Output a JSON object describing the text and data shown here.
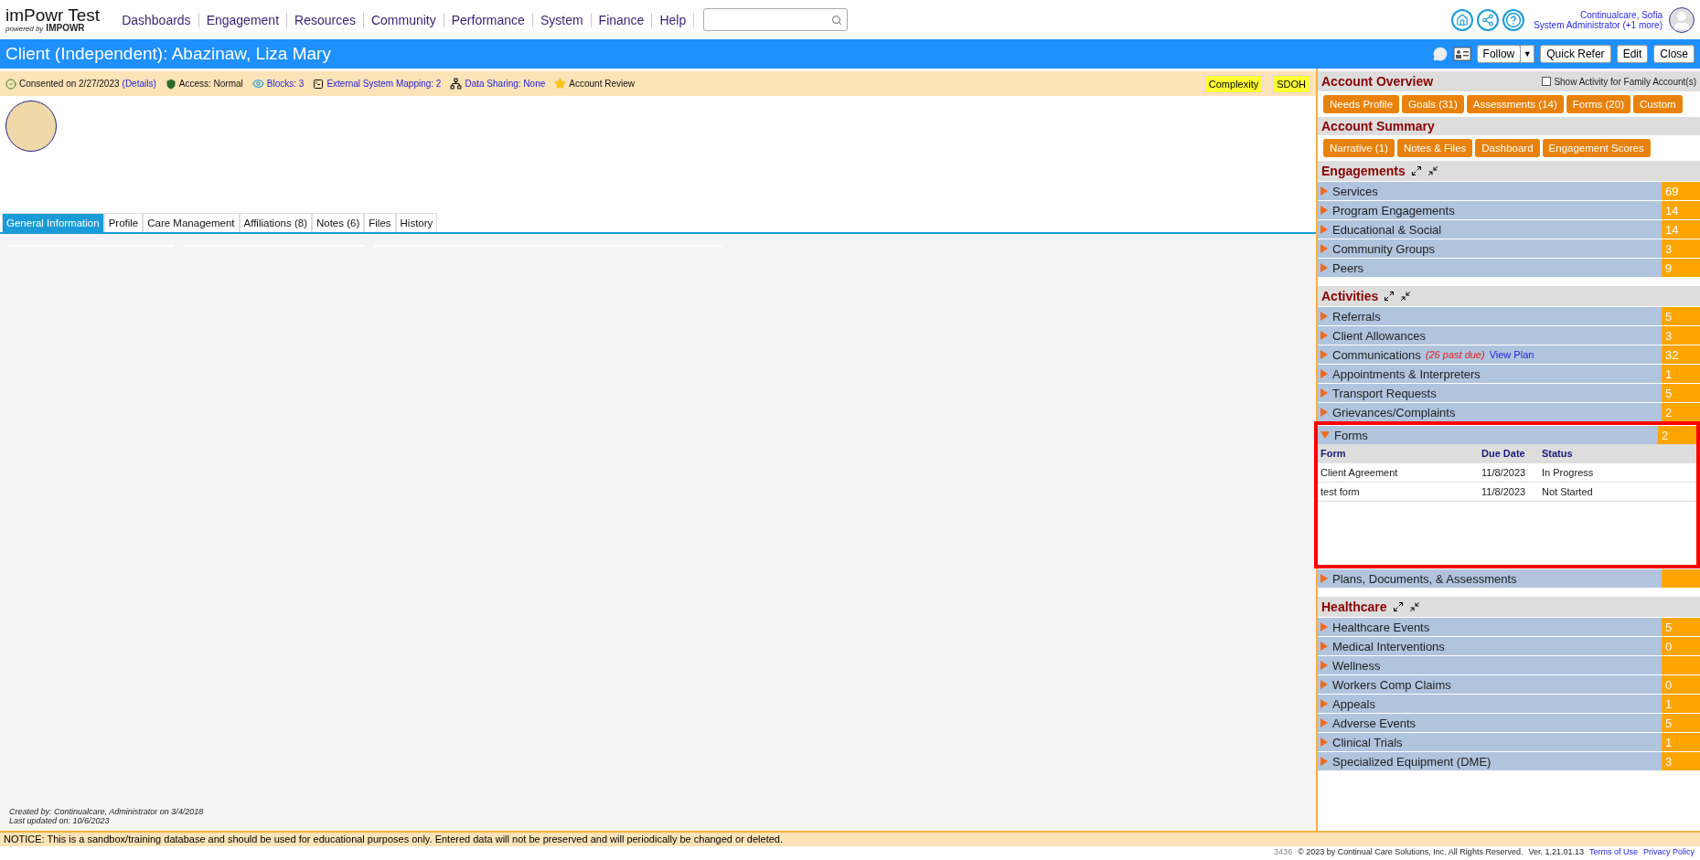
{
  "header": {
    "app_title": "imPowr Test",
    "powered_by": "powered by",
    "brand": "IMPOWR",
    "nav": [
      "Dashboards",
      "Engagement",
      "Resources",
      "Community",
      "Performance",
      "System",
      "Finance",
      "Help"
    ],
    "user": {
      "name": "Continualcare, Sofia",
      "role": "System Administrator (+1 more)"
    }
  },
  "title_bar": {
    "title": "Client (Independent): Abazinaw, Liza Mary",
    "follow": "Follow",
    "follow_menu": "▼",
    "buttons": [
      "Quick Refer",
      "Edit",
      "Close"
    ]
  },
  "info_bar": {
    "items": [
      {
        "kind": "consent",
        "text": "Consented on 2/27/2023",
        "detail": "(Details)",
        "link": false
      },
      {
        "kind": "access",
        "text": "Access: Normal",
        "link": false
      },
      {
        "kind": "blocks",
        "text": "Blocks: 3",
        "link": true
      },
      {
        "kind": "mapping",
        "text": "External System Mapping: 2",
        "link": true
      },
      {
        "kind": "sharing",
        "text": "Data Sharing: None",
        "link": true
      },
      {
        "kind": "review",
        "text": "Account Review",
        "link": false
      }
    ],
    "tags": [
      "Complexity",
      "SDOH"
    ]
  },
  "tabs": [
    {
      "label": "General Information",
      "selected": true
    },
    {
      "label": "Profile",
      "selected": false
    },
    {
      "label": "Care Management",
      "selected": false
    },
    {
      "label": "Affiliations (8)",
      "selected": false
    },
    {
      "label": "Notes (6)",
      "selected": false
    },
    {
      "label": "Files",
      "selected": false
    },
    {
      "label": "History",
      "selected": false
    }
  ],
  "record_info": {
    "created": "Created by: Continualcare, Administrator on 3/4/2018",
    "updated": "Last updated on: 10/6/2023"
  },
  "account_overview": {
    "title": "Account Overview",
    "family_toggle": {
      "label": "Show Activity for Family Account(s)",
      "checked": false
    },
    "buttons": [
      "Needs Profile",
      "Goals (31)",
      "Assessments (14)",
      "Forms (20)",
      "Custom"
    ]
  },
  "account_summary": {
    "title": "Account Summary",
    "buttons": [
      "Narrative (1)",
      "Notes & Files",
      "Dashboard",
      "Engagement Scores"
    ]
  },
  "sections": [
    {
      "title": "Engagements",
      "rows": [
        {
          "label": "Services",
          "count": "69",
          "expanded": false,
          "highlighted": false
        },
        {
          "label": "Program Engagements",
          "count": "14",
          "expanded": false,
          "highlighted": false
        },
        {
          "label": "Educational & Social",
          "count": "14",
          "expanded": false,
          "highlighted": false
        },
        {
          "label": "Community Groups",
          "count": "3",
          "expanded": false,
          "highlighted": false
        },
        {
          "label": "Peers",
          "count": "9",
          "expanded": false,
          "highlighted": false
        }
      ]
    },
    {
      "title": "Activities",
      "rows": [
        {
          "label": "Referrals",
          "count": "5",
          "expanded": false,
          "highlighted": false
        },
        {
          "label": "Client Allowances",
          "count": "3",
          "expanded": false,
          "highlighted": false
        },
        {
          "label": "Communications",
          "note": "(26 past due)",
          "link": "View Plan",
          "count": "32",
          "expanded": false,
          "highlighted": false
        },
        {
          "label": "Appointments & Interpreters",
          "count": "1",
          "expanded": false,
          "highlighted": false
        },
        {
          "label": "Transport Requests",
          "count": "5",
          "expanded": false,
          "highlighted": false
        },
        {
          "label": "Grievances/Complaints",
          "count": "2",
          "expanded": false,
          "highlighted": false
        },
        {
          "label": "Forms",
          "count": "2",
          "expanded": true,
          "highlighted": true,
          "table": {
            "columns": [
              "Form",
              "Due Date",
              "Status"
            ],
            "rows": [
              [
                "Client Agreement",
                "11/8/2023",
                "In Progress"
              ],
              [
                "test form",
                "11/8/2023",
                "Not Started"
              ]
            ]
          }
        },
        {
          "label": "Plans, Documents, & Assessments",
          "expanded": false,
          "highlighted": false
        }
      ]
    },
    {
      "title": "Healthcare",
      "rows": [
        {
          "label": "Healthcare Events",
          "count": "5",
          "expanded": false,
          "highlighted": false
        },
        {
          "label": "Medical Interventions",
          "count": "0",
          "expanded": false,
          "highlighted": false
        },
        {
          "label": "Wellness",
          "expanded": false,
          "highlighted": false
        },
        {
          "label": "Workers Comp Claims",
          "count": "0",
          "expanded": false,
          "highlighted": false
        },
        {
          "label": "Appeals",
          "count": "1",
          "expanded": false,
          "highlighted": false
        },
        {
          "label": "Adverse Events",
          "count": "5",
          "expanded": false,
          "highlighted": false
        },
        {
          "label": "Clinical Trials",
          "count": "1",
          "expanded": false,
          "highlighted": false
        },
        {
          "label": "Specialized Equipment (DME)",
          "count": "3",
          "expanded": false,
          "highlighted": false
        }
      ]
    }
  ],
  "footer": {
    "notice": "NOTICE: This is a sandbox/training database and should be used for educational purposes only. Entered data will not be preserved and will periodically be changed or deleted.",
    "build": "3436",
    "copyright": "© 2023 by Continual Care Solutions, Inc. All Rights Reserved.",
    "version": "Ver. 1.21.01.13",
    "links": [
      "Terms of Use",
      "Privacy Policy"
    ]
  }
}
